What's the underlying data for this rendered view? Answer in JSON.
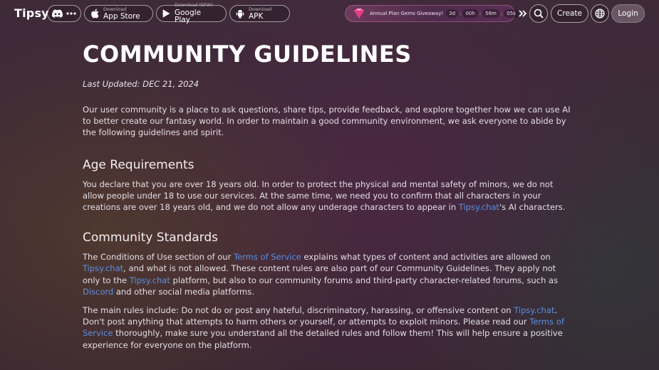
{
  "header": {
    "logo": "Tipsy",
    "app_store": {
      "small": "Download",
      "big": "App Store"
    },
    "google_play": {
      "small": "Download (SFW)",
      "big": "Google Play"
    },
    "apk": {
      "small": "Download",
      "big": "APK"
    },
    "promo": {
      "text": "Annual Plan Gems Giveaway!",
      "countdown": {
        "days": "3d",
        "hours": "00h",
        "minutes": "56m",
        "seconds": "05s"
      },
      "separator": ":"
    },
    "create_label": "Create",
    "login_label": "Login"
  },
  "content": {
    "title": "COMMUNITY GUIDELINES",
    "last_updated": "Last Updated: DEC 21, 2024",
    "intro": "Our user community is a place to ask questions, share tips, provide feedback, and explore together how we can use AI to better create our fantasy world. In order to maintain a good community environment, we ask everyone to abide by the following guidelines and spirit.",
    "age": {
      "heading": "Age Requirements",
      "text_1": "You declare that you are over 18 years old. In order to protect the physical and mental safety of minors, we do not allow people under 18 to use our services. At the same time, we need you to confirm that all characters in your creations are over 18 years old, and we do not allow any underage characters to appear in ",
      "link": "Tipsy.chat",
      "text_2": "'s AI characters."
    },
    "standards": {
      "heading": "Community Standards",
      "p1": {
        "t1": "The Conditions of Use section of our ",
        "l1": "Terms of Service",
        "t2": " explains what types of content and activities are allowed on ",
        "l2": "Tipsy.chat",
        "t3": ", and what is not allowed. These content rules are also part of our Community Guidelines. They apply not only to the ",
        "l3": "Tipsy.chat",
        "t4": " platform, but also to our community forums and third-party character-related forums, such as ",
        "l4": "Discord",
        "t5": " and other social media platforms."
      },
      "p2": {
        "t1": "The main rules include: Do not do or post any hateful, discriminatory, harassing, or offensive content on ",
        "l1": "Tipsy.chat",
        "t2": ". Don't post anything that attempts to harm others or yourself, or attempts to exploit minors. Please read our ",
        "l2": "Terms of Service",
        "t3": " thoroughly, make sure you understand all the detailed rules and follow them! This will help ensure a positive experience for everyone on the platform."
      }
    }
  },
  "icons": {
    "discord": "discord-icon",
    "more": "more-icon",
    "apple": "apple-icon",
    "play": "google-play-icon",
    "android": "android-icon",
    "gem": "gem-icon",
    "chevrons": "double-chevron-right-icon",
    "search": "search-icon",
    "globe": "globe-icon"
  },
  "colors": {
    "link": "#5b8fe0",
    "promo_start": "#6e3a5c",
    "login_bg": "#6a5565"
  }
}
